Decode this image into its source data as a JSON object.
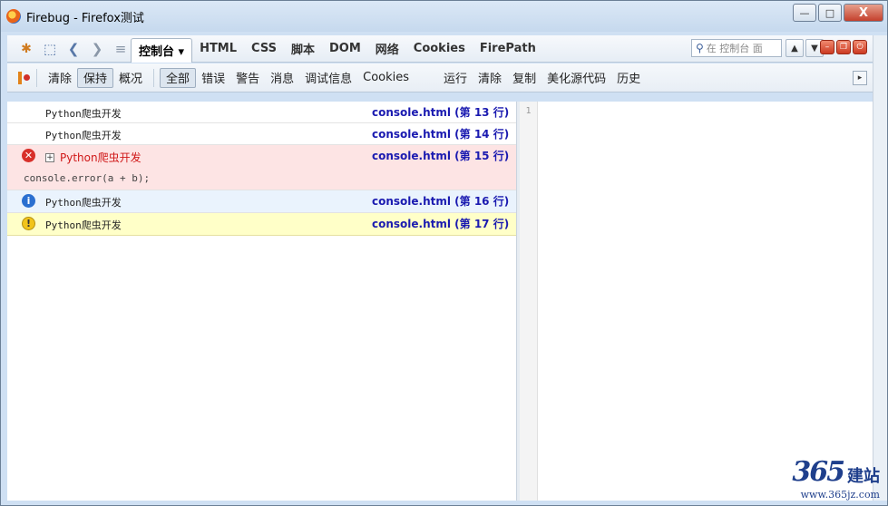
{
  "window": {
    "title": "Firebug - Firefox测试",
    "buttons": {
      "minimize": "—",
      "maximize": "□",
      "close": "X"
    }
  },
  "toolbar": {
    "icons": [
      "bug-icon",
      "inspect-icon",
      "back-icon",
      "forward-icon",
      "command-editor-icon"
    ],
    "tabs": [
      {
        "label": "控制台 ▾",
        "active": true
      },
      {
        "label": "HTML"
      },
      {
        "label": "CSS"
      },
      {
        "label": "脚本"
      },
      {
        "label": "DOM"
      },
      {
        "label": "网络"
      },
      {
        "label": "Cookies"
      },
      {
        "label": "FirePath"
      }
    ],
    "search_placeholder": "在 控制台 面",
    "nav_up": "▲",
    "nav_down": "▼"
  },
  "console_toolbar": {
    "clear": "清除",
    "persist": "保持",
    "profile": "概况",
    "filters": [
      "全部",
      "错误",
      "警告",
      "消息",
      "调试信息",
      "Cookies"
    ],
    "active_filter": "全部",
    "editor_actions": [
      "运行",
      "清除",
      "复制",
      "美化源代码",
      "历史"
    ]
  },
  "log_entries": [
    {
      "type": "log",
      "message": "Python爬虫开发",
      "source": "console.html (第 13 行)"
    },
    {
      "type": "log",
      "message": "Python爬虫开发",
      "source": "console.html (第 14 行)"
    },
    {
      "type": "error",
      "message": "Python爬虫开发",
      "code": "console.error(a + b);",
      "source": "console.html (第 15 行)"
    },
    {
      "type": "info",
      "message": "Python爬虫开发",
      "source": "console.html (第 16 行)"
    },
    {
      "type": "warn",
      "message": "Python爬虫开发",
      "source": "console.html (第 17 行)"
    }
  ],
  "editor": {
    "line_number": "1"
  },
  "watermark": {
    "number": "365",
    "text": "建站",
    "url": "www.365jz.com"
  }
}
